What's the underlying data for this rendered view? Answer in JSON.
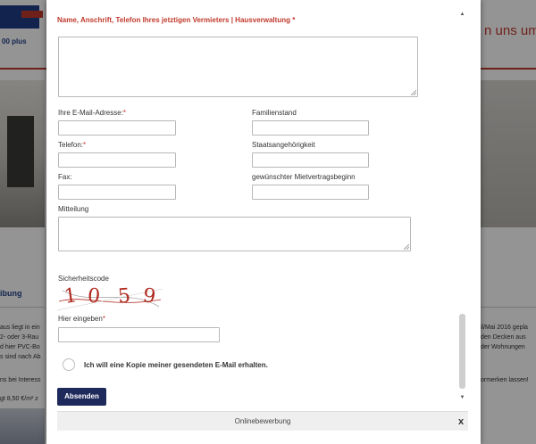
{
  "background": {
    "logo_sub": "00 plus",
    "slogan": "n uns um",
    "section_heading": "ibung",
    "left_lines": [
      "aus liegt in ein",
      "2- oder 3-Rau",
      "d hier PVC-Bo",
      "s sind nach Ab",
      "ns bei Interess",
      "gt 8,50 €/m² z"
    ],
    "right_lines": [
      "il/Mai 2016 gepla",
      "den Decken aus",
      "der Wohnungen",
      "ormerken lassen!"
    ]
  },
  "form": {
    "section_title": "Name, Anschrift, Telefon Ihres jetztigen Vermieters | Hausverwaltung *",
    "email_label": "Ihre E-Mail-Adresse:",
    "email_req": "*",
    "family_status_label": "Familienstand",
    "phone_label": "Telefon:",
    "phone_req": "*",
    "nationality_label": "Staatsangehörigkeit",
    "fax_label": "Fax:",
    "move_in_label": "gewünschter Mietvertragsbeginn",
    "message_label": "Mitteilung",
    "captcha_label": "Sicherheitscode",
    "captcha_chars": [
      "1",
      "0",
      "5",
      "9"
    ],
    "enter_here_label": "Hier eingeben",
    "enter_here_req": "*",
    "copy_checkbox_label": "Ich will eine Kopie meiner gesendeten E-Mail erhalten.",
    "submit_label": "Absenden"
  },
  "scrollbar": {
    "up": "▲",
    "down": "▼"
  },
  "modal_footer": {
    "title": "Onlinebewerbung",
    "close": "x"
  }
}
